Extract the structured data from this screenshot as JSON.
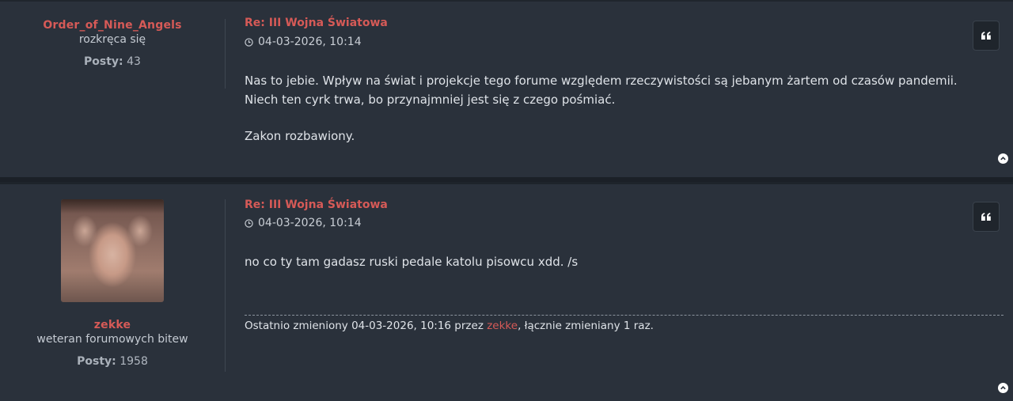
{
  "posts": [
    {
      "author": {
        "username": "Order_of_Nine_Angels",
        "rank": "rozkręca się",
        "posts_label": "Posty:",
        "posts_count": "43",
        "has_avatar": false
      },
      "title": "Re: III Wojna Światowa",
      "date": "04-03-2026, 10:14",
      "body": [
        "Nas to jebie. Wpływ na świat i projekcje tego forume względem rzeczywistości są jebanym żartem od czasów pandemii. Niech ten cyrk trwa, bo przynajmniej jest się z czego pośmiać.",
        "Zakon rozbawiony."
      ],
      "quote_icon": "quote-icon",
      "top_icon": "chevron-up-icon"
    },
    {
      "author": {
        "username": "zekke",
        "rank": "weteran forumowych bitew",
        "posts_label": "Posty:",
        "posts_count": "1958",
        "has_avatar": true
      },
      "title": "Re: III Wojna Światowa",
      "date": "04-03-2026, 10:14",
      "body": [
        "no co ty tam gadasz ruski pedale katolu pisowcu xdd. /s"
      ],
      "edit_notice": {
        "prefix": "Ostatnio zmieniony 04-03-2026, 10:16 przez ",
        "user": "zekke",
        "suffix": ", łącznie zmieniany 1 raz."
      },
      "quote_icon": "quote-icon",
      "top_icon": "chevron-up-icon"
    }
  ],
  "colors": {
    "accent": "#d65a57",
    "post_bg": "#2a313b",
    "page_bg": "#1b2027",
    "text": "#dfe3e8"
  }
}
